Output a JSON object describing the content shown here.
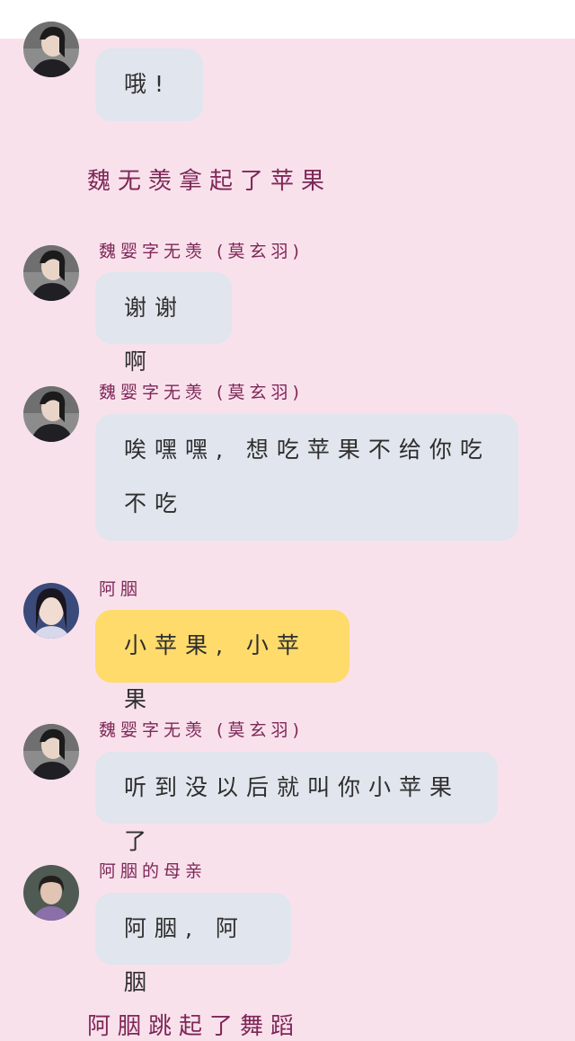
{
  "colors": {
    "background": "#f9e1ec",
    "bubble_grey": "#e1e5ed",
    "bubble_yellow": "#fedb6b",
    "name_text": "#7d2757"
  },
  "messages": [
    {
      "name": "",
      "text": "哦!",
      "avatar": "weiying-avatar"
    },
    {
      "narration": "魏无羡拿起了苹果"
    },
    {
      "name": "魏婴字无羡 (莫玄羽)",
      "text": "谢谢啊",
      "avatar": "weiying-avatar"
    },
    {
      "name": "魏婴字无羡 (莫玄羽)",
      "text": "唉嘿嘿, 想吃苹果不给你吃 不吃",
      "avatar": "weiying-avatar"
    },
    {
      "name": "阿胭",
      "text": "小苹果, 小苹果",
      "avatar": "ayan-avatar"
    },
    {
      "name": "魏婴字无羡 (莫玄羽)",
      "text": "听到没以后就叫你小苹果了",
      "avatar": "weiying-avatar"
    },
    {
      "name": "阿胭的母亲",
      "text": "阿胭, 阿胭",
      "avatar": "ayan-mother-avatar"
    },
    {
      "narration": "阿胭跳起了舞蹈"
    }
  ]
}
